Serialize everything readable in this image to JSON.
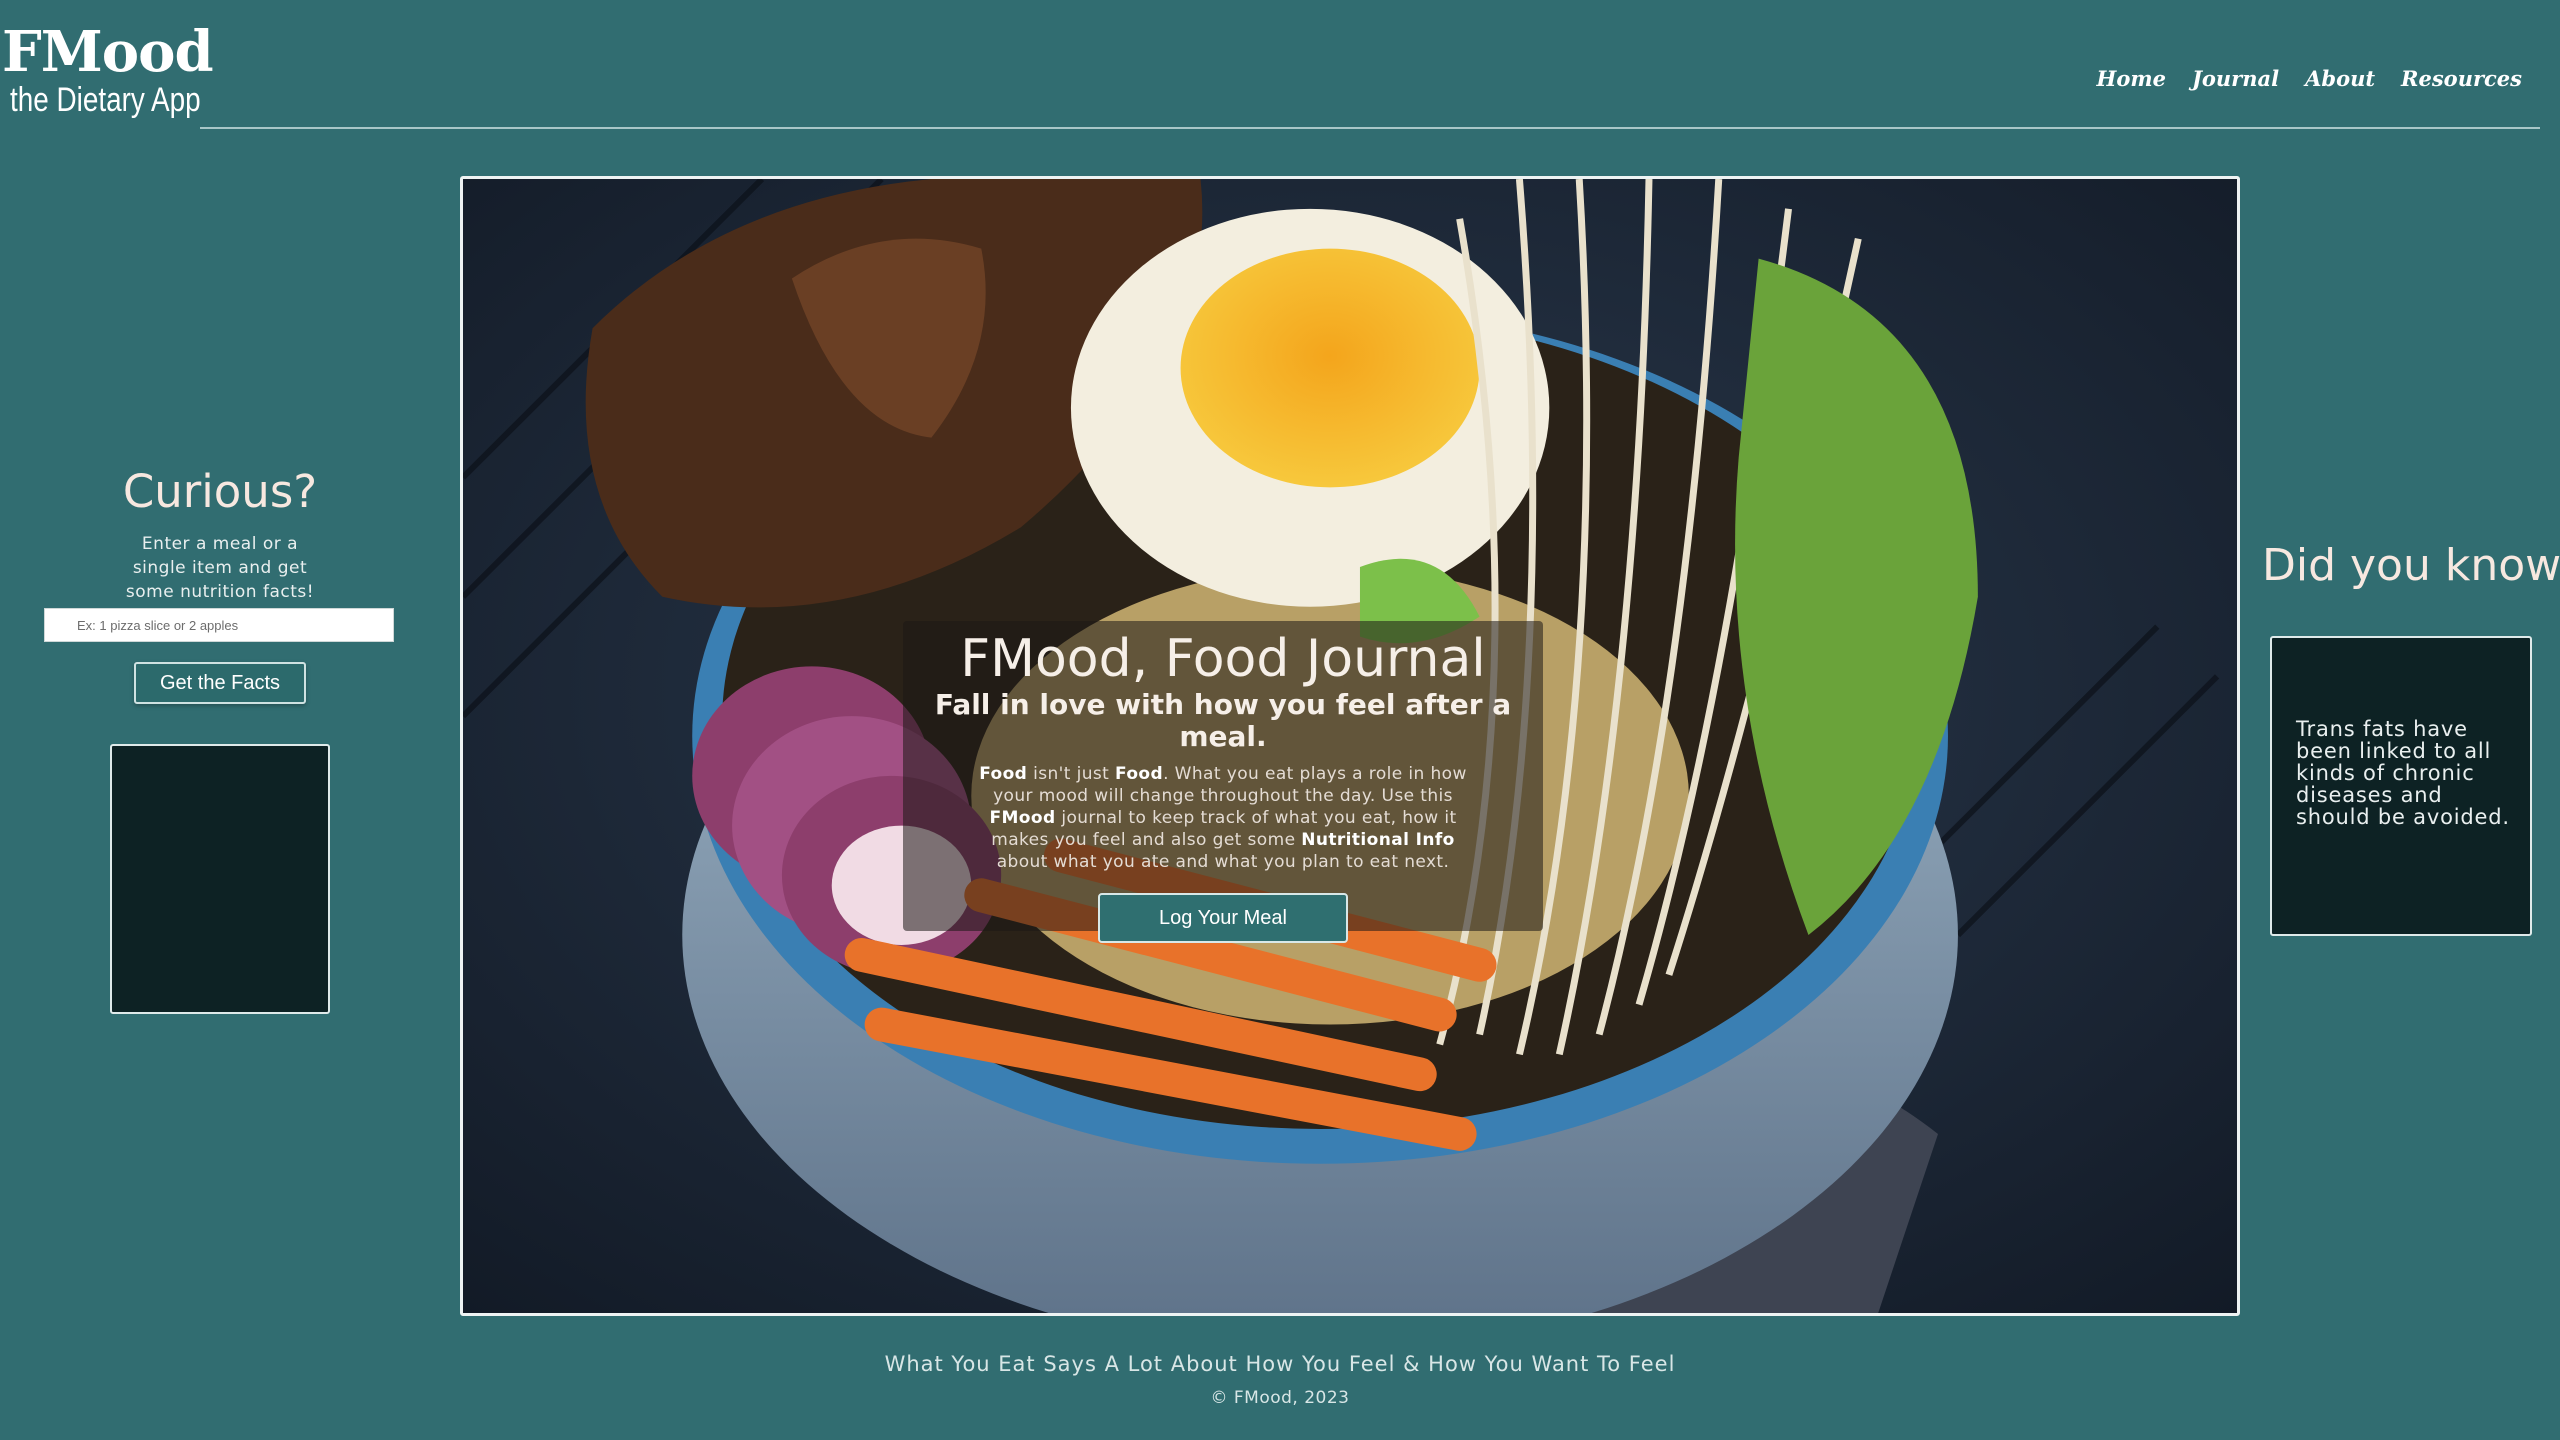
{
  "header": {
    "logo_title": "FMood",
    "logo_subtitle": "the Dietary App",
    "nav": [
      {
        "label": "Home"
      },
      {
        "label": "Journal"
      },
      {
        "label": "About"
      },
      {
        "label": "Resources"
      }
    ]
  },
  "curious": {
    "heading": "Curious?",
    "description": "Enter a meal or a single item and get some nutrition facts!",
    "input_placeholder": "Ex: 1 pizza slice or 2 apples",
    "button_label": "Get the Facts"
  },
  "hero": {
    "title": "FMood, Food Journal",
    "subtitle": "Fall in love with how you feel after a meal.",
    "text_parts": [
      "Food",
      " isn't just ",
      "Food",
      ". What you eat plays a role in how your mood will change throughout the day. Use this ",
      "FMood",
      " journal to keep track of what you eat, how it makes you feel and also get some ",
      "Nutritional Info",
      " about what you ate and what you plan to eat next."
    ],
    "button_label": "Log Your Meal"
  },
  "did_you_know": {
    "heading": "Did you know?",
    "fact": "Trans fats have been linked to all kinds of chronic diseases and should be avoided."
  },
  "footer": {
    "tagline": "What You Eat Says A Lot About How You Feel & How You Want To Feel",
    "copyright": "© FMood, 2023"
  },
  "colors": {
    "background": "#316d71",
    "panel": "#0d2224",
    "button": "#2f6f70"
  }
}
